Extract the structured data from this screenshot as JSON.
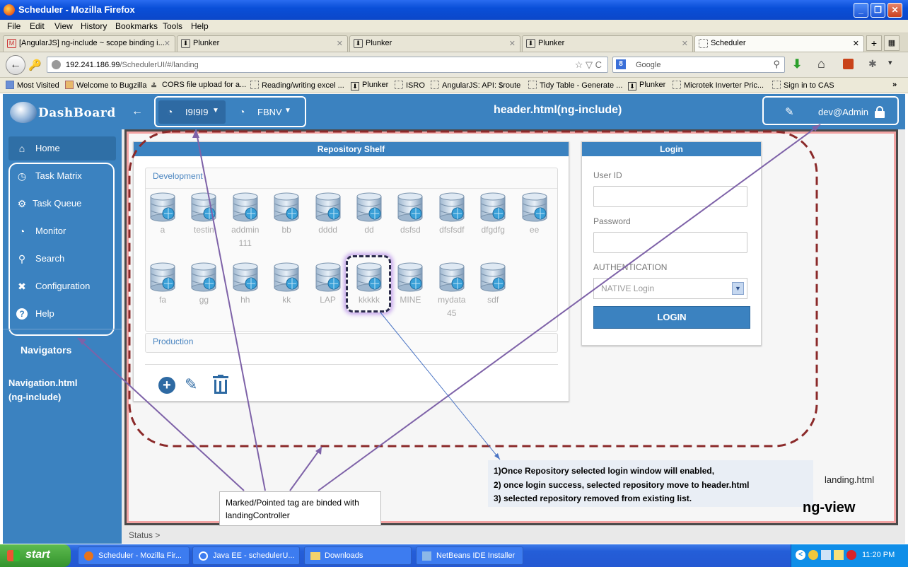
{
  "window": {
    "title": "Scheduler - Mozilla Firefox"
  },
  "menu": [
    "File",
    "Edit",
    "View",
    "History",
    "Bookmarks",
    "Tools",
    "Help"
  ],
  "tabs": [
    {
      "label": "[AngularJS] ng-include ~ scope binding i..."
    },
    {
      "label": "Plunker"
    },
    {
      "label": "Plunker"
    },
    {
      "label": "Plunker"
    },
    {
      "label": "Scheduler"
    }
  ],
  "nav": {
    "url_host": "192.241.186.99",
    "url_path": "/SchedulerUI/#/landing",
    "search_placeholder": "Google"
  },
  "bookmarks": [
    "Most Visited",
    "Welcome to Bugzilla",
    "CORS file upload for a...",
    "Reading/writing excel ...",
    "Plunker",
    "ISRO",
    "AngularJS: API: $route",
    "Tidy Table - Generate ...",
    "Plunker",
    "Microtek Inverter Pric...",
    "Sign in to CAS"
  ],
  "app": {
    "logo": "DashBoard",
    "header_tabs": [
      "I9I9I9",
      "FBNV"
    ],
    "header_annotation": "header.html(ng-include)",
    "user": "dev@Admin",
    "nav_items": [
      "Home",
      "Task Matrix",
      "Task Queue",
      "Monitor",
      "Search",
      "Configuration",
      "Help"
    ],
    "navigators_annotation": "Navigators",
    "navigation_annotation": "Navigation.html\n(ng-include)"
  },
  "repository": {
    "title": "Repository Shelf",
    "development_label": "Development",
    "production_label": "Production",
    "row1": [
      "a",
      "testin",
      "addmin\n111",
      "bb",
      "dddd",
      "dd",
      "dsfsd",
      "dfsfsdf",
      "dfgdfg",
      "ee"
    ],
    "row2": [
      "fa",
      "gg",
      "hh",
      "kk",
      "LAP",
      "kkkkk",
      "MINE",
      "mydata\n45",
      "sdf"
    ]
  },
  "login": {
    "title": "Login",
    "user_id_label": "User ID",
    "password_label": "Password",
    "auth_label": "AUTHENTICATION",
    "auth_value": "NATIVE Login",
    "button": "LOGIN"
  },
  "notes": {
    "line1": "1)Once Repository selected login window will enabled,",
    "line2": "2) once login success, selected repository move to header.html",
    "line3": "3) selected repository removed from existing list.",
    "callout": "Marked/Pointed tag are binded with landingController",
    "landing": "landing.html",
    "ngview": "ng-view"
  },
  "status": "Status >",
  "taskbar": {
    "start": "start",
    "items": [
      "Scheduler - Mozilla Fir...",
      "Java EE - schedulerU...",
      "Downloads",
      "NetBeans IDE Installer"
    ],
    "time": "11:20 PM"
  },
  "colors": {
    "app_blue": "#3b82c0",
    "annotation_red": "#8b2a2a",
    "annotation_purple": "#7e62a8"
  }
}
